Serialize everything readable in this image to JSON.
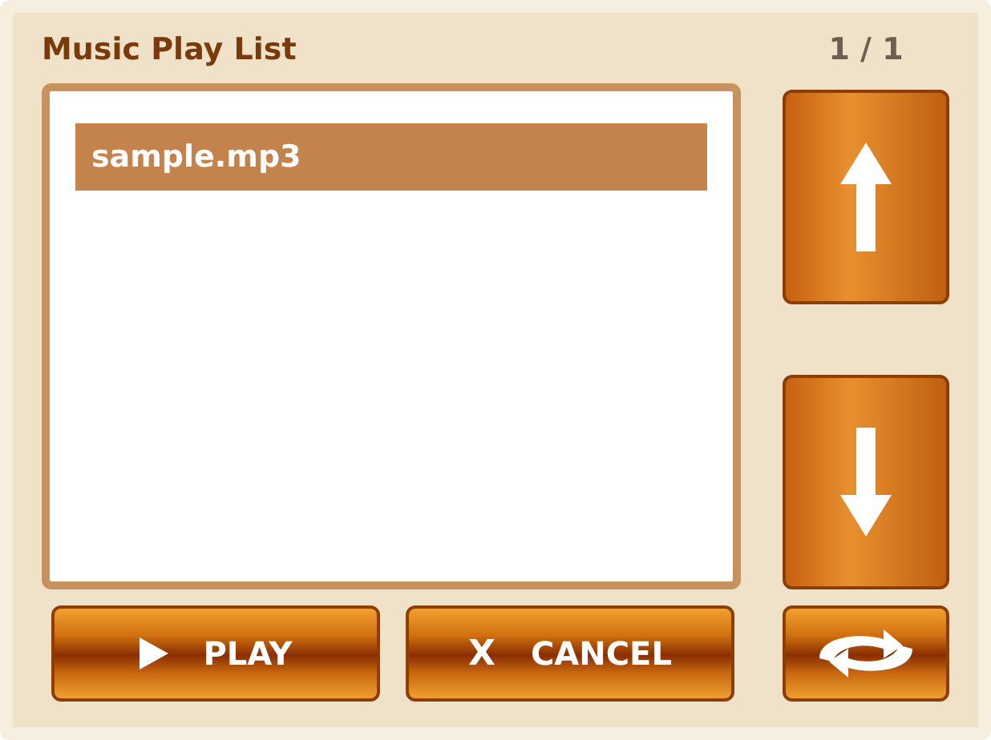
{
  "title": "Music Play List",
  "page_counter": "1 / 1",
  "playlist": [
    {
      "name": "sample.mp3",
      "selected": true
    }
  ],
  "buttons": [
    {
      "kind": "play",
      "label": "PLAY"
    },
    {
      "kind": "cancel",
      "icon_char": "X",
      "label": "CANCEL"
    }
  ]
}
